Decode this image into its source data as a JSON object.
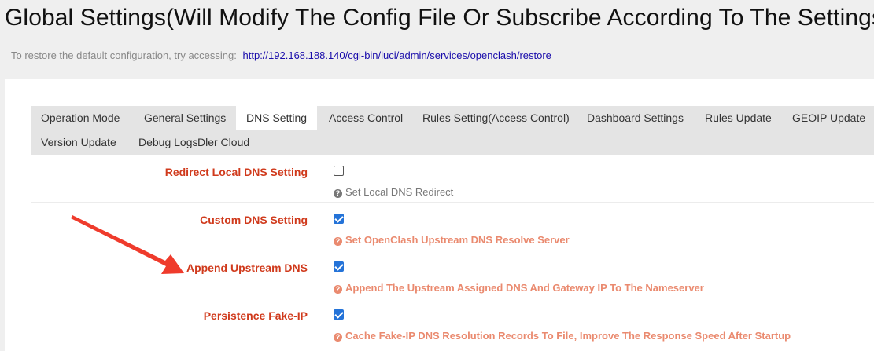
{
  "header": {
    "title": "Global Settings(Will Modify The Config File Or Subscribe According To The Settings",
    "restore_hint": "To restore the default configuration, try accessing:",
    "restore_link": "http://192.168.188.140/cgi-bin/luci/admin/services/openclash/restore"
  },
  "tabs": [
    {
      "label": "Operation Mode",
      "active": false
    },
    {
      "label": "General Settings",
      "active": false
    },
    {
      "label": "DNS Setting",
      "active": true
    },
    {
      "label": "Access Control",
      "active": false
    },
    {
      "label": "Rules Setting(Access Control)",
      "active": false
    },
    {
      "label": "Dashboard Settings",
      "active": false
    },
    {
      "label": "Rules Update",
      "active": false
    },
    {
      "label": "GEOIP Update",
      "active": false
    },
    {
      "label": "Version Update",
      "active": false
    },
    {
      "label": "Debug Logs",
      "active": false
    },
    {
      "label": "Dler Cloud",
      "active": false
    }
  ],
  "settings": [
    {
      "label": "Redirect Local DNS Setting",
      "checked": false,
      "help": "Set Local DNS Redirect"
    },
    {
      "label": "Custom DNS Setting",
      "checked": true,
      "help": "Set OpenClash Upstream DNS Resolve Server"
    },
    {
      "label": "Append Upstream DNS",
      "checked": true,
      "help": "Append The Upstream Assigned DNS And Gateway IP To The Nameserver"
    },
    {
      "label": "Persistence Fake-IP",
      "checked": true,
      "help": "Cache Fake-IP DNS Resolution Records To File, Improve The Response Speed After Startup"
    }
  ],
  "colors": {
    "label": "#d03a1c",
    "help_highlight": "#ea8a6f",
    "checkbox": "#2473d8",
    "arrow": "#ef3b2c"
  }
}
